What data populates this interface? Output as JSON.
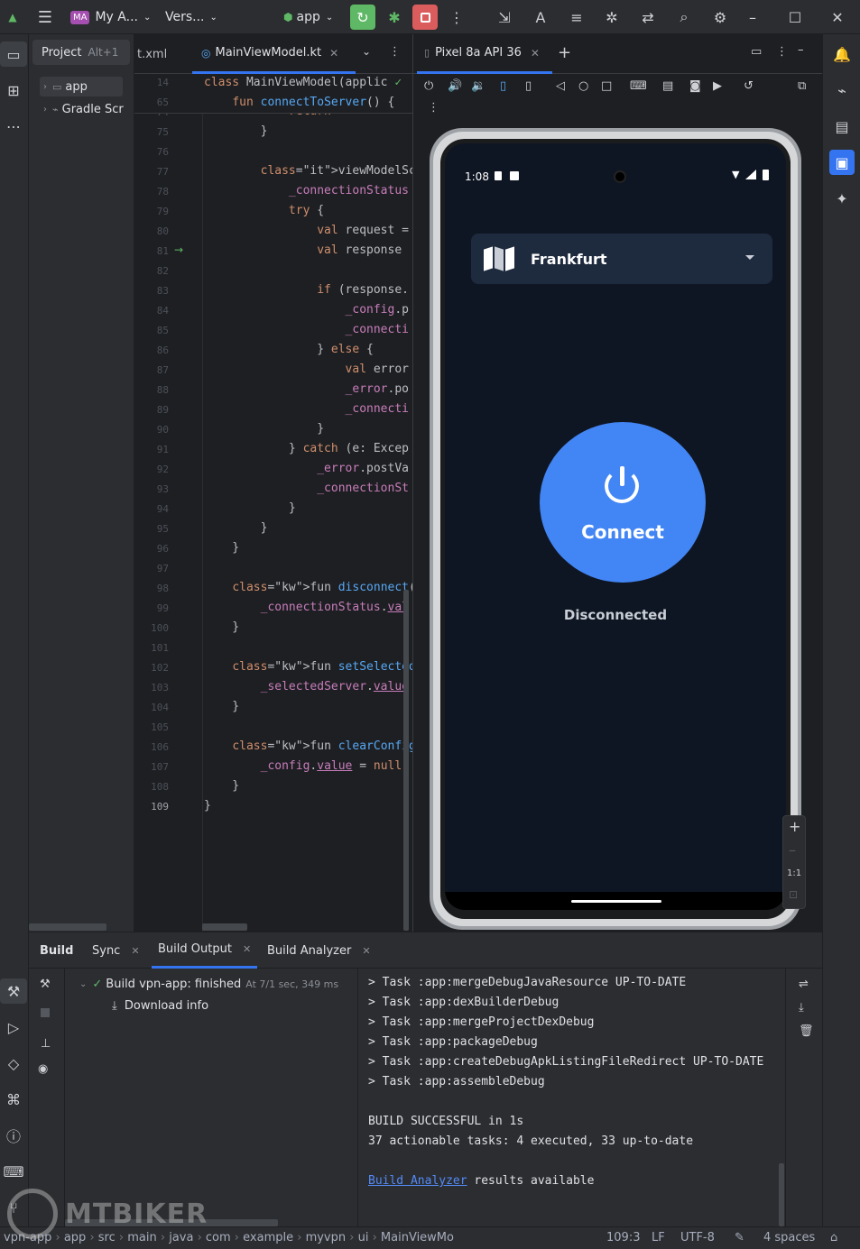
{
  "titlebar": {
    "project_badge": "MA",
    "project_name": "My A...",
    "vcs": "Vers...",
    "run_config": "app"
  },
  "project_panel": {
    "tab_label": "Project",
    "tab_shortcut": "Alt+1",
    "items": [
      {
        "label": "app"
      },
      {
        "label": "Gradle Scr"
      }
    ]
  },
  "editor": {
    "tabs": [
      {
        "label": "t.xml"
      },
      {
        "label": "MainViewModel.kt"
      }
    ],
    "sticky": [
      {
        "ln": "14",
        "code": "class MainViewModel(applic"
      },
      {
        "ln": "65",
        "code": "    fun connectToServer() {"
      }
    ],
    "lines": [
      {
        "ln": "74",
        "code": "            return"
      },
      {
        "ln": "75",
        "code": "        }"
      },
      {
        "ln": "76",
        "code": ""
      },
      {
        "ln": "77",
        "code": "        viewModelScope.launch"
      },
      {
        "ln": "78",
        "code": "            _connectionStatus"
      },
      {
        "ln": "79",
        "code": "            try {"
      },
      {
        "ln": "80",
        "code": "                val request ="
      },
      {
        "ln": "81",
        "code": "                val response"
      },
      {
        "ln": "82",
        "code": ""
      },
      {
        "ln": "83",
        "code": "                if (response."
      },
      {
        "ln": "84",
        "code": "                    _config.p"
      },
      {
        "ln": "85",
        "code": "                    _connecti"
      },
      {
        "ln": "86",
        "code": "                } else {"
      },
      {
        "ln": "87",
        "code": "                    val error"
      },
      {
        "ln": "88",
        "code": "                    _error.po"
      },
      {
        "ln": "89",
        "code": "                    _connecti"
      },
      {
        "ln": "90",
        "code": "                }"
      },
      {
        "ln": "91",
        "code": "            } catch (e: Excep"
      },
      {
        "ln": "92",
        "code": "                _error.postVa"
      },
      {
        "ln": "93",
        "code": "                _connectionSt"
      },
      {
        "ln": "94",
        "code": "            }"
      },
      {
        "ln": "95",
        "code": "        }"
      },
      {
        "ln": "96",
        "code": "    }"
      },
      {
        "ln": "97",
        "code": ""
      },
      {
        "ln": "98",
        "code": "    fun disconnect() {"
      },
      {
        "ln": "99",
        "code": "        _connectionStatus.val"
      },
      {
        "ln": "100",
        "code": "    }"
      },
      {
        "ln": "101",
        "code": ""
      },
      {
        "ln": "102",
        "code": "    fun setSelectedServer(ser"
      },
      {
        "ln": "103",
        "code": "        _selectedServer.value"
      },
      {
        "ln": "104",
        "code": "    }"
      },
      {
        "ln": "105",
        "code": ""
      },
      {
        "ln": "106",
        "code": "    fun clearConfig() {"
      },
      {
        "ln": "107",
        "code": "        _config.value = null"
      },
      {
        "ln": "108",
        "code": "    }"
      },
      {
        "ln": "109",
        "code": "}"
      }
    ]
  },
  "emulator": {
    "tab_label": "Pixel 8a API 36",
    "zoom_label": "1:1",
    "phone": {
      "time": "1:08",
      "server": "Frankfurt",
      "connect_label": "Connect",
      "status": "Disconnected"
    }
  },
  "build": {
    "tabs": [
      {
        "label": "Build"
      },
      {
        "label": "Sync"
      },
      {
        "label": "Build Output"
      },
      {
        "label": "Build Analyzer"
      }
    ],
    "tree_title": "Build vpn-app: finished",
    "tree_time": "At 7/1 sec, 349 ms",
    "tree_child": "Download info",
    "output": [
      "> Task :app:mergeDebugJavaResource UP-TO-DATE",
      "> Task :app:dexBuilderDebug",
      "> Task :app:mergeProjectDexDebug",
      "> Task :app:packageDebug",
      "> Task :app:createDebugApkListingFileRedirect UP-TO-DATE",
      "> Task :app:assembleDebug",
      "",
      "BUILD SUCCESSFUL in 1s",
      "37 actionable tasks: 4 executed, 33 up-to-date",
      ""
    ],
    "analyzer_link": "Build Analyzer",
    "analyzer_rest": " results available"
  },
  "statusbar": {
    "crumbs": [
      "vpn-app",
      "app",
      "src",
      "main",
      "java",
      "com",
      "example",
      "myvpn",
      "ui",
      "MainViewMo"
    ],
    "position": "109:3",
    "line_sep": "LF",
    "encoding": "UTF-8",
    "indent": "4 spaces"
  },
  "watermark": "MTBIKER",
  "colors": {
    "accent": "#3574f0",
    "connect_button": "#4285f4",
    "phone_bg": "#0f1623",
    "run_green": "#5fb865",
    "stop_red": "#db5c5c"
  }
}
